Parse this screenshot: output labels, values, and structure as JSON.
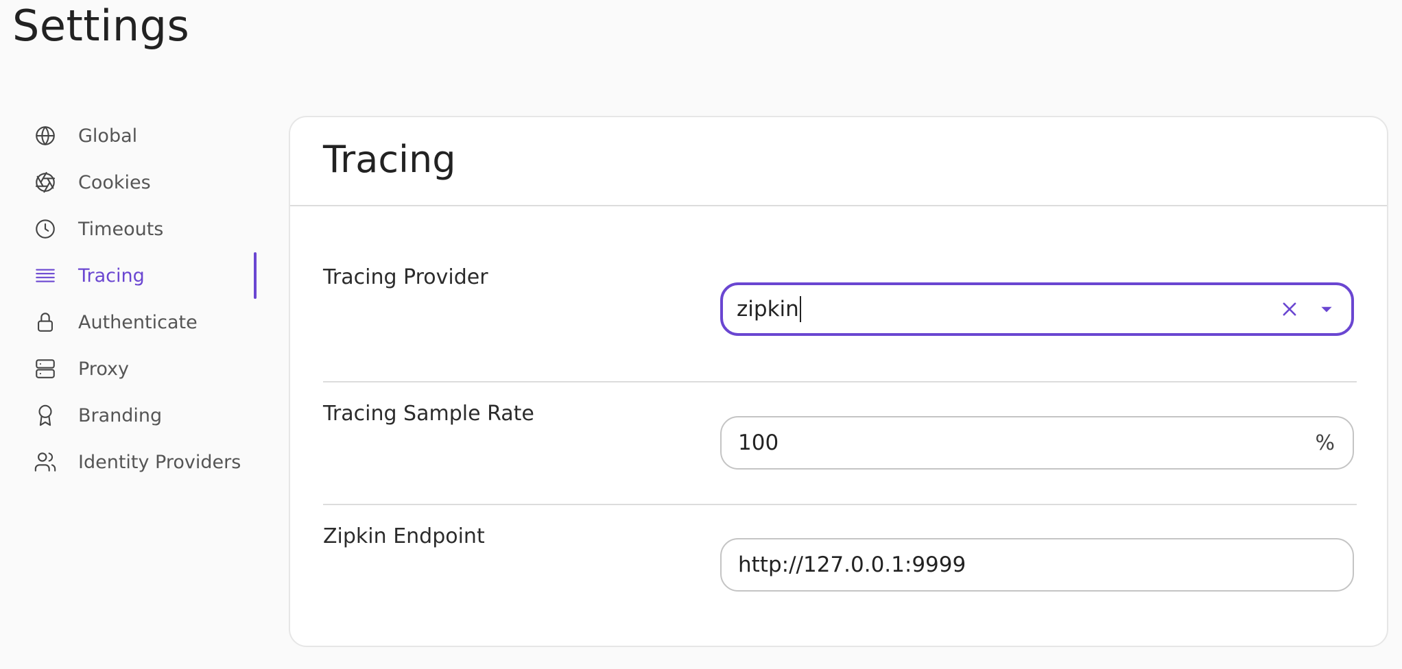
{
  "page": {
    "title": "Settings"
  },
  "sidebar": {
    "items": [
      {
        "label": "Global",
        "icon": "globe-icon",
        "active": false
      },
      {
        "label": "Cookies",
        "icon": "aperture-icon",
        "active": false
      },
      {
        "label": "Timeouts",
        "icon": "clock-icon",
        "active": false
      },
      {
        "label": "Tracing",
        "icon": "lines-icon",
        "active": true
      },
      {
        "label": "Authenticate",
        "icon": "lock-icon",
        "active": false
      },
      {
        "label": "Proxy",
        "icon": "server-icon",
        "active": false
      },
      {
        "label": "Branding",
        "icon": "award-icon",
        "active": false
      },
      {
        "label": "Identity Providers",
        "icon": "users-icon",
        "active": false
      }
    ]
  },
  "section": {
    "title": "Tracing",
    "fields": {
      "provider": {
        "label": "Tracing Provider",
        "value": "zipkin"
      },
      "sample_rate": {
        "label": "Tracing Sample Rate",
        "value": "100",
        "suffix": "%"
      },
      "zipkin_endpoint": {
        "label": "Zipkin Endpoint",
        "value": "http://127.0.0.1:9999"
      }
    }
  },
  "colors": {
    "accent": "#6a46d1",
    "text": "#2b2b2b",
    "muted": "#555555",
    "background": "#fafafa",
    "card": "#ffffff"
  }
}
